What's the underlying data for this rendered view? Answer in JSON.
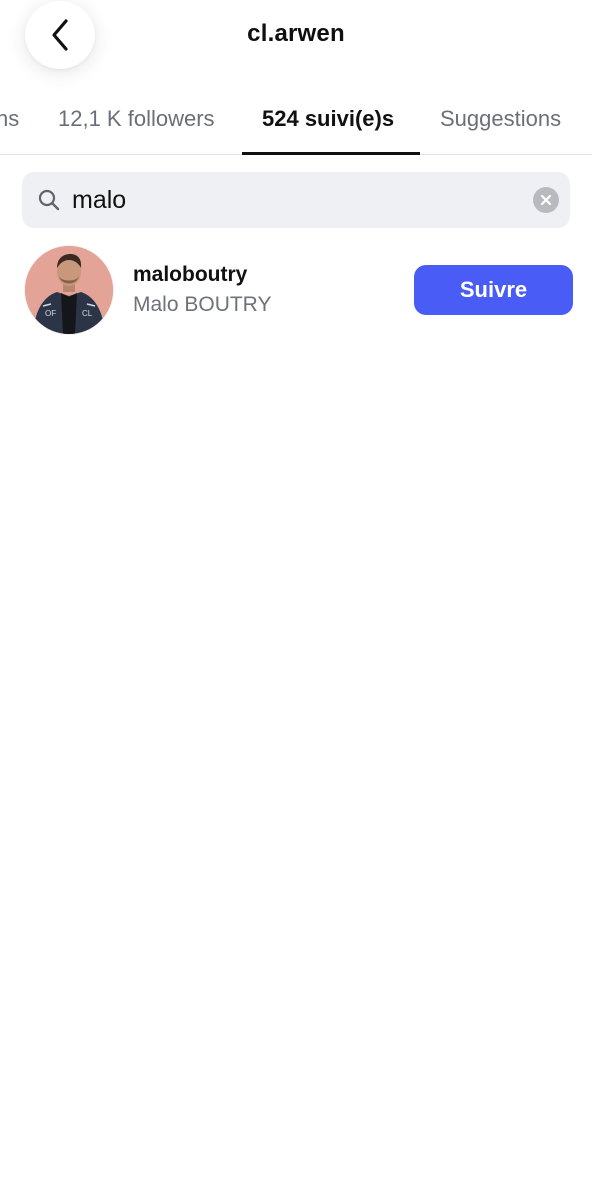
{
  "header": {
    "title": "cl.arwen",
    "back_icon": "chevron-left-icon"
  },
  "tabs": [
    {
      "label": "ns",
      "active": false
    },
    {
      "label": "12,1 K followers",
      "active": false
    },
    {
      "label": "524 suivi(e)s",
      "active": true
    },
    {
      "label": "Suggestions",
      "active": false
    }
  ],
  "search": {
    "value": "malo",
    "icon": "search-icon",
    "clear_icon": "clear-icon"
  },
  "results": [
    {
      "username": "maloboutry",
      "fullname": "Malo BOUTRY",
      "follow_label": "Suivre"
    }
  ],
  "colors": {
    "accent": "#4a5cf6",
    "search_bg": "#eff0f3",
    "muted_text": "#6b6f78"
  }
}
